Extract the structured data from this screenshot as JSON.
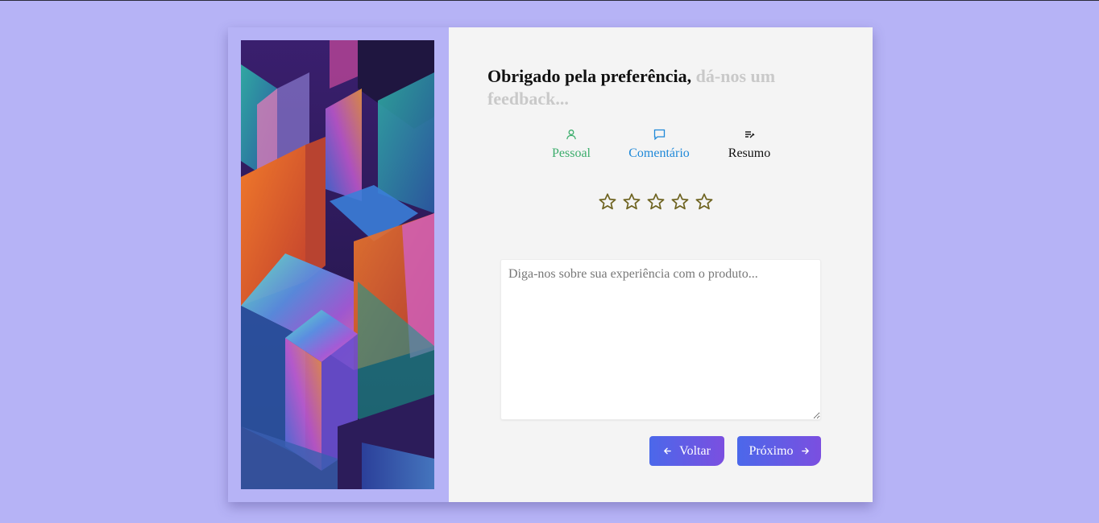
{
  "header": {
    "title_strong": "Obrigado pela preferência,",
    "title_muted": "dá-nos um feedback..."
  },
  "steps": [
    {
      "label": "Pessoal",
      "icon": "user-icon",
      "color": "#3cad6c"
    },
    {
      "label": "Comentário",
      "icon": "comment-icon",
      "color": "#1e88d8"
    },
    {
      "label": "Resumo",
      "icon": "list-edit-icon",
      "color": "#111111"
    }
  ],
  "rating": {
    "max": 5,
    "value": 0,
    "star_color": "#6e6320"
  },
  "feedback": {
    "value": "",
    "placeholder": "Diga-nos sobre sua experiência com o produto..."
  },
  "buttons": {
    "back_label": "Voltar",
    "next_label": "Próximo"
  },
  "colors": {
    "background": "#b6b3f6",
    "panel": "#f4f4f4",
    "button_start": "#4b68ea",
    "button_end": "#7b4fe0"
  }
}
